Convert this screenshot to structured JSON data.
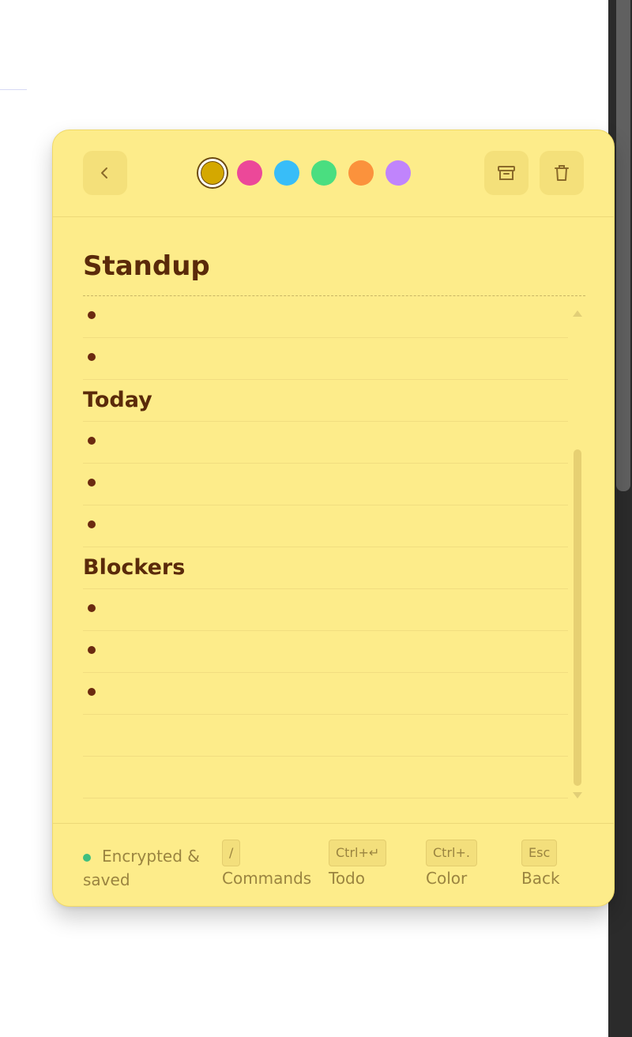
{
  "note": {
    "title": "Standup",
    "colors": [
      {
        "name": "yellow",
        "hex": "#d4a800",
        "selected": true
      },
      {
        "name": "pink",
        "hex": "#ec4899",
        "selected": false
      },
      {
        "name": "blue",
        "hex": "#38bdf8",
        "selected": false
      },
      {
        "name": "green",
        "hex": "#4ade80",
        "selected": false
      },
      {
        "name": "orange",
        "hex": "#fb923c",
        "selected": false
      },
      {
        "name": "purple",
        "hex": "#c084fc",
        "selected": false
      }
    ],
    "toolbar": {
      "back_icon": "chevron-left-icon",
      "archive_icon": "archive-icon",
      "trash_icon": "trash-icon"
    },
    "lines": [
      {
        "type": "bullet",
        "text": ""
      },
      {
        "type": "bullet",
        "text": ""
      },
      {
        "type": "heading",
        "text": "Today"
      },
      {
        "type": "bullet",
        "text": ""
      },
      {
        "type": "bullet",
        "text": ""
      },
      {
        "type": "bullet",
        "text": ""
      },
      {
        "type": "heading",
        "text": "Blockers"
      },
      {
        "type": "bullet",
        "text": ""
      },
      {
        "type": "bullet",
        "text": ""
      },
      {
        "type": "bullet",
        "text": ""
      },
      {
        "type": "empty",
        "text": ""
      },
      {
        "type": "empty",
        "text": ""
      }
    ]
  },
  "footer": {
    "status": "Encrypted & saved",
    "hints": [
      {
        "key": "/",
        "label": "Commands"
      },
      {
        "key": "Ctrl+↵",
        "label": "Todo"
      },
      {
        "key": "Ctrl+.",
        "label": "Color"
      },
      {
        "key": "Esc",
        "label": "Back"
      }
    ]
  }
}
